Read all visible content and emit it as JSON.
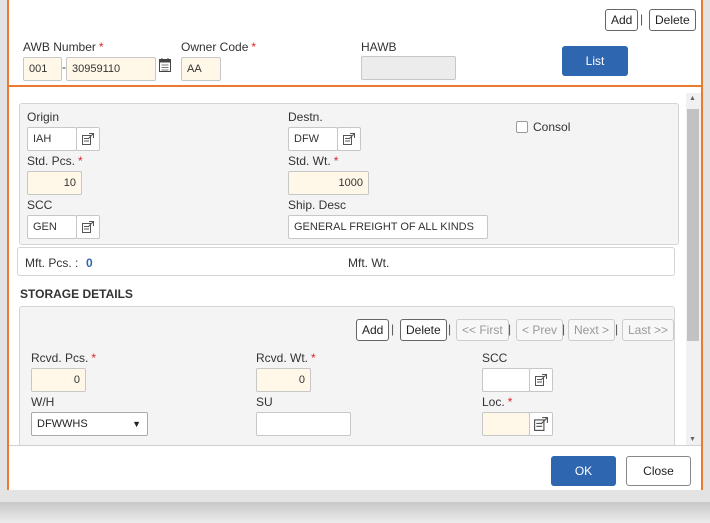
{
  "header": {
    "add_label": "Add",
    "delete_label": "Delete",
    "separator": "|",
    "awb_number_label": "AWB Number",
    "awb_prefix": "001",
    "awb_dash": "-",
    "awb_number": "30959110",
    "owner_code_label": "Owner Code",
    "owner_code": "AA",
    "hawb_label": "HAWB",
    "hawb": "",
    "list_label": "List",
    "required_mark": "*"
  },
  "shipment": {
    "origin_label": "Origin",
    "origin": "IAH",
    "destn_label": "Destn.",
    "destn": "DFW",
    "consol_label": "Consol",
    "std_pcs_label": "Std. Pcs.",
    "std_pcs": "10",
    "std_wt_label": "Std. Wt.",
    "std_wt": "1000",
    "scc_label": "SCC",
    "scc": "GEN",
    "ship_desc_label": "Ship. Desc",
    "ship_desc": "GENERAL FREIGHT OF ALL KINDS"
  },
  "manifest": {
    "mft_pcs_label": "Mft. Pcs. :",
    "mft_pcs": "0",
    "mft_wt_label": "Mft. Wt."
  },
  "storage": {
    "title": "STORAGE DETAILS",
    "add_label": "Add",
    "delete_label": "Delete",
    "first_label": "<< First",
    "prev_label": "< Prev",
    "next_label": "Next >",
    "last_label": "Last >>",
    "separator": "|",
    "rcvd_pcs_label": "Rcvd. Pcs.",
    "rcvd_pcs": "0",
    "rcvd_wt_label": "Rcvd. Wt.",
    "rcvd_wt": "0",
    "scc_label": "SCC",
    "scc": "",
    "wh_label": "W/H",
    "wh_value": "DFWWHS",
    "su_label": "SU",
    "su": "",
    "loc_label": "Loc.",
    "loc": ""
  },
  "footer": {
    "ok_label": "OK",
    "close_label": "Close"
  }
}
